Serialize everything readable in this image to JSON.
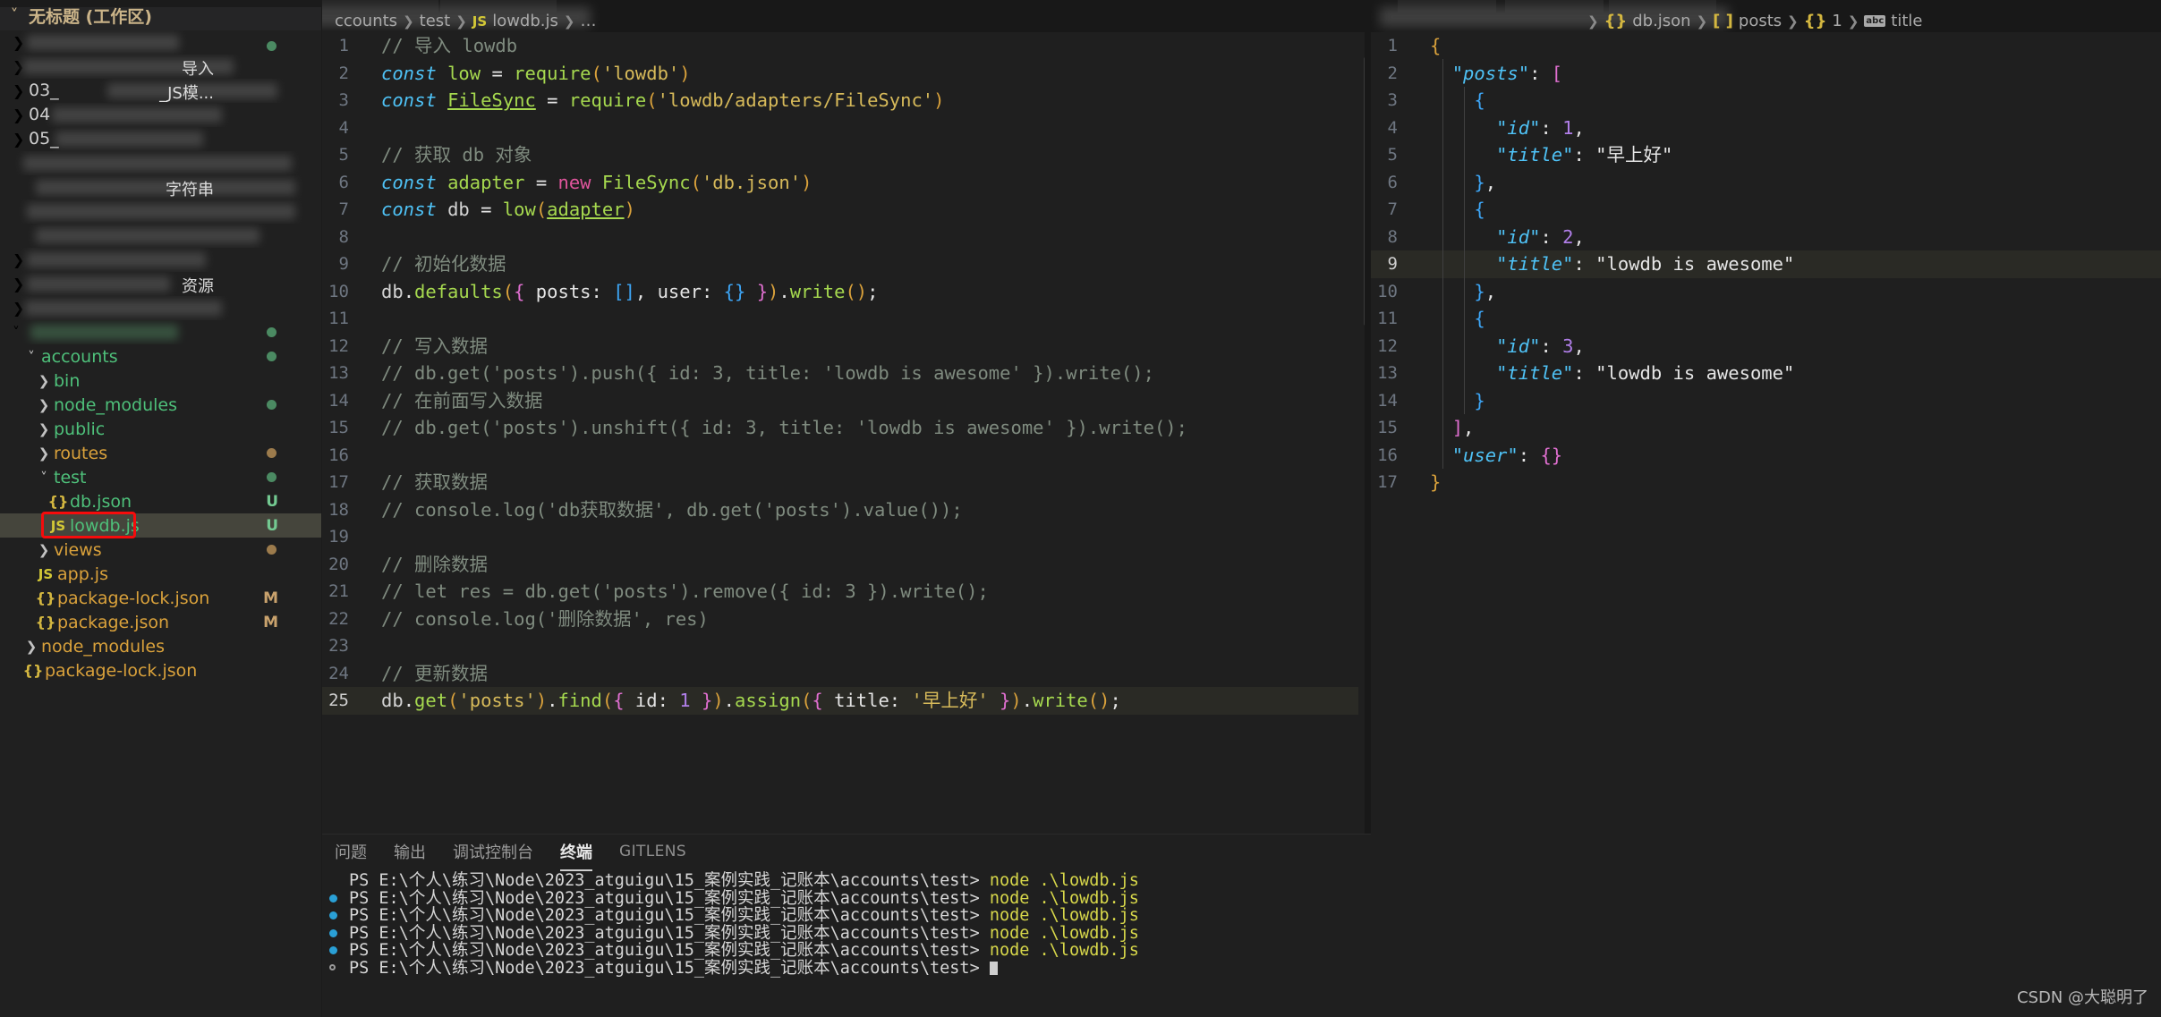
{
  "workspace": {
    "title": "无标题 (工作区)",
    "chevron": "chevron-down-icon"
  },
  "sidebar": {
    "blurred_items": [
      {
        "stub": "",
        "hint": ""
      },
      {
        "stub": "",
        "hint": "导入"
      },
      {
        "stub": "03_",
        "hint": "_JS模..."
      },
      {
        "stub": "04",
        "hint": ""
      },
      {
        "stub": "05_",
        "hint": ""
      },
      {
        "stub": "",
        "hint": ""
      },
      {
        "stub": "",
        "hint": "字符串"
      },
      {
        "stub": "",
        "hint": ""
      },
      {
        "stub": "",
        "hint": ""
      },
      {
        "stub": "",
        "hint": ""
      },
      {
        "stub": "",
        "hint": "资源"
      },
      {
        "stub": "",
        "hint": ""
      }
    ],
    "tree": [
      {
        "name": "accounts",
        "kind": "folder",
        "indent": 1,
        "expanded": true,
        "color": "green",
        "badge": "",
        "dot": "green"
      },
      {
        "name": "bin",
        "kind": "folder",
        "indent": 2,
        "expanded": false,
        "color": "green",
        "badge": "",
        "dot": ""
      },
      {
        "name": "node_modules",
        "kind": "folder",
        "indent": 2,
        "expanded": false,
        "color": "green",
        "badge": "",
        "dot": "green"
      },
      {
        "name": "public",
        "kind": "folder",
        "indent": 2,
        "expanded": false,
        "color": "green",
        "badge": "",
        "dot": ""
      },
      {
        "name": "routes",
        "kind": "folder",
        "indent": 2,
        "expanded": false,
        "color": "amber",
        "badge": "",
        "dot": "amber"
      },
      {
        "name": "test",
        "kind": "folder",
        "indent": 2,
        "expanded": true,
        "color": "green",
        "badge": "",
        "dot": "green"
      },
      {
        "name": "db.json",
        "kind": "json",
        "indent": 3,
        "expanded": null,
        "color": "green",
        "badge": "U",
        "dot": ""
      },
      {
        "name": "lowdb.js",
        "kind": "js",
        "indent": 3,
        "expanded": null,
        "color": "green",
        "badge": "U",
        "dot": "",
        "selected": true
      },
      {
        "name": "views",
        "kind": "folder",
        "indent": 2,
        "expanded": false,
        "color": "amber",
        "badge": "",
        "dot": "amber"
      },
      {
        "name": "app.js",
        "kind": "js",
        "indent": 2,
        "expanded": null,
        "color": "amber",
        "badge": "",
        "dot": ""
      },
      {
        "name": "package-lock.json",
        "kind": "json",
        "indent": 2,
        "expanded": null,
        "color": "amber",
        "badge": "M",
        "dot": ""
      },
      {
        "name": "package.json",
        "kind": "json",
        "indent": 2,
        "expanded": null,
        "color": "amber",
        "badge": "M",
        "dot": ""
      },
      {
        "name": "node_modules",
        "kind": "folder",
        "indent": 1,
        "expanded": false,
        "color": "amber",
        "badge": "",
        "dot": ""
      },
      {
        "name": "package-lock.json",
        "kind": "json",
        "indent": 1,
        "expanded": null,
        "color": "amber",
        "badge": "",
        "dot": ""
      }
    ]
  },
  "left_editor": {
    "breadcrumb": {
      "path_tail": "ccounts",
      "sep": "❯",
      "folder": "test",
      "file": "lowdb.js",
      "js_icon": "js-file-icon",
      "ellipsis": "…"
    },
    "active_line": 25,
    "lines": [
      {
        "n": 1,
        "tokens": [
          [
            "t-cmt",
            "// 导入 lowdb"
          ]
        ]
      },
      {
        "n": 2,
        "tokens": [
          [
            "t-kw",
            "const"
          ],
          [
            "t-plain",
            " "
          ],
          [
            "t-fn",
            "low"
          ],
          [
            "t-plain",
            " "
          ],
          [
            "t-op",
            "="
          ],
          [
            "t-plain",
            " "
          ],
          [
            "t-fn",
            "require"
          ],
          [
            "t-brk1",
            "("
          ],
          [
            "t-str",
            "'lowdb'"
          ],
          [
            "t-brk1",
            ")"
          ]
        ]
      },
      {
        "n": 3,
        "tokens": [
          [
            "t-kw",
            "const"
          ],
          [
            "t-plain",
            " "
          ],
          [
            "t-cls",
            "FileSync"
          ],
          [
            "t-plain",
            " "
          ],
          [
            "t-op",
            "="
          ],
          [
            "t-plain",
            " "
          ],
          [
            "t-fn",
            "require"
          ],
          [
            "t-brk1",
            "("
          ],
          [
            "t-str",
            "'lowdb/adapters/FileSync'"
          ],
          [
            "t-brk1",
            ")"
          ]
        ]
      },
      {
        "n": 4,
        "tokens": []
      },
      {
        "n": 5,
        "tokens": [
          [
            "t-cmt",
            "// 获取 db 对象"
          ]
        ]
      },
      {
        "n": 6,
        "tokens": [
          [
            "t-kw",
            "const"
          ],
          [
            "t-plain",
            " "
          ],
          [
            "t-fn",
            "adapter"
          ],
          [
            "t-plain",
            " "
          ],
          [
            "t-op",
            "="
          ],
          [
            "t-plain",
            " "
          ],
          [
            "t-new",
            "new"
          ],
          [
            "t-plain",
            " "
          ],
          [
            "t-fn",
            "FileSync"
          ],
          [
            "t-brk1",
            "("
          ],
          [
            "t-str",
            "'db.json'"
          ],
          [
            "t-brk1",
            ")"
          ]
        ]
      },
      {
        "n": 7,
        "tokens": [
          [
            "t-kw",
            "const"
          ],
          [
            "t-plain",
            " "
          ],
          [
            "t-id",
            "db"
          ],
          [
            "t-plain",
            " "
          ],
          [
            "t-op",
            "="
          ],
          [
            "t-plain",
            " "
          ],
          [
            "t-fn",
            "low"
          ],
          [
            "t-brk1",
            "("
          ],
          [
            "t-cls",
            "adapter"
          ],
          [
            "t-brk1",
            ")"
          ]
        ]
      },
      {
        "n": 8,
        "tokens": []
      },
      {
        "n": 9,
        "tokens": [
          [
            "t-cmt",
            "// 初始化数据"
          ]
        ]
      },
      {
        "n": 10,
        "tokens": [
          [
            "t-id",
            "db"
          ],
          [
            "t-plain",
            "."
          ],
          [
            "t-prop",
            "defaults"
          ],
          [
            "t-brk1",
            "("
          ],
          [
            "t-brk2",
            "{"
          ],
          [
            "t-plain",
            " posts: "
          ],
          [
            "t-brk3",
            "[]"
          ],
          [
            "t-plain",
            ", user: "
          ],
          [
            "t-brk3",
            "{}"
          ],
          [
            "t-plain",
            " "
          ],
          [
            "t-brk2",
            "}"
          ],
          [
            "t-brk1",
            ")"
          ],
          [
            "t-plain",
            "."
          ],
          [
            "t-prop",
            "write"
          ],
          [
            "t-brk1",
            "()"
          ],
          [
            "t-plain",
            ";"
          ]
        ]
      },
      {
        "n": 11,
        "tokens": []
      },
      {
        "n": 12,
        "tokens": [
          [
            "t-cmt",
            "// 写入数据"
          ]
        ]
      },
      {
        "n": 13,
        "tokens": [
          [
            "t-cmt",
            "// db.get('posts').push({ id: 3, title: 'lowdb is awesome' }).write();"
          ]
        ]
      },
      {
        "n": 14,
        "tokens": [
          [
            "t-cmt",
            "// 在前面写入数据"
          ]
        ]
      },
      {
        "n": 15,
        "tokens": [
          [
            "t-cmt",
            "// db.get('posts').unshift({ id: 3, title: 'lowdb is awesome' }).write();"
          ]
        ]
      },
      {
        "n": 16,
        "tokens": []
      },
      {
        "n": 17,
        "tokens": [
          [
            "t-cmt",
            "// 获取数据"
          ]
        ]
      },
      {
        "n": 18,
        "tokens": [
          [
            "t-cmt",
            "// console.log('db获取数据', db.get('posts').value());"
          ]
        ]
      },
      {
        "n": 19,
        "tokens": []
      },
      {
        "n": 20,
        "tokens": [
          [
            "t-cmt",
            "// 删除数据"
          ]
        ]
      },
      {
        "n": 21,
        "tokens": [
          [
            "t-cmt",
            "// let res = db.get('posts').remove({ id: 3 }).write();"
          ]
        ]
      },
      {
        "n": 22,
        "tokens": [
          [
            "t-cmt",
            "// console.log('删除数据', res)"
          ]
        ]
      },
      {
        "n": 23,
        "tokens": []
      },
      {
        "n": 24,
        "tokens": [
          [
            "t-cmt",
            "// 更新数据"
          ]
        ]
      },
      {
        "n": 25,
        "tokens": [
          [
            "t-id",
            "db"
          ],
          [
            "t-plain",
            "."
          ],
          [
            "t-prop",
            "get"
          ],
          [
            "t-brk1",
            "("
          ],
          [
            "t-str",
            "'posts'"
          ],
          [
            "t-brk1",
            ")"
          ],
          [
            "t-plain",
            "."
          ],
          [
            "t-prop",
            "find"
          ],
          [
            "t-brk1",
            "("
          ],
          [
            "t-brk2",
            "{"
          ],
          [
            "t-plain",
            " id: "
          ],
          [
            "t-num",
            "1"
          ],
          [
            "t-plain",
            " "
          ],
          [
            "t-brk2",
            "}"
          ],
          [
            "t-brk1",
            ")"
          ],
          [
            "t-plain",
            "."
          ],
          [
            "t-prop",
            "assign"
          ],
          [
            "t-brk1",
            "("
          ],
          [
            "t-brk2",
            "{"
          ],
          [
            "t-plain",
            " title: "
          ],
          [
            "t-str",
            "'早上好'"
          ],
          [
            "t-plain",
            " "
          ],
          [
            "t-brk2",
            "}"
          ],
          [
            "t-brk1",
            ")"
          ],
          [
            "t-plain",
            "."
          ],
          [
            "t-prop",
            "write"
          ],
          [
            "t-brk1",
            "()"
          ],
          [
            "t-plain",
            ";"
          ]
        ]
      }
    ]
  },
  "right_editor": {
    "breadcrumb": {
      "sep": "❯",
      "file": "db.json",
      "array": "posts",
      "object": "1",
      "field": "title",
      "json_icon": "json-file-icon",
      "array_icon": "array-icon",
      "object_icon": "object-icon",
      "string_icon": "string-field-icon"
    },
    "active_line": 9,
    "lines": [
      {
        "n": 1,
        "tokens": [
          [
            "j-b1",
            "{"
          ]
        ]
      },
      {
        "n": 2,
        "tokens": [
          [
            "j-p",
            "  "
          ],
          [
            "j-key",
            "\"posts\""
          ],
          [
            "j-p",
            ": "
          ],
          [
            "j-b2",
            "["
          ]
        ]
      },
      {
        "n": 3,
        "tokens": [
          [
            "j-p",
            "    "
          ],
          [
            "j-b3",
            "{"
          ]
        ]
      },
      {
        "n": 4,
        "tokens": [
          [
            "j-p",
            "      "
          ],
          [
            "j-key",
            "\"id\""
          ],
          [
            "j-p",
            ": "
          ],
          [
            "j-num",
            "1"
          ],
          [
            "j-p",
            ","
          ]
        ]
      },
      {
        "n": 5,
        "tokens": [
          [
            "j-p",
            "      "
          ],
          [
            "j-key",
            "\"title\""
          ],
          [
            "j-p",
            ": "
          ],
          [
            "j-str",
            "\"早上好\""
          ]
        ]
      },
      {
        "n": 6,
        "tokens": [
          [
            "j-p",
            "    "
          ],
          [
            "j-b3",
            "}"
          ],
          [
            "j-p",
            ","
          ]
        ]
      },
      {
        "n": 7,
        "tokens": [
          [
            "j-p",
            "    "
          ],
          [
            "j-b3",
            "{"
          ]
        ]
      },
      {
        "n": 8,
        "tokens": [
          [
            "j-p",
            "      "
          ],
          [
            "j-key",
            "\"id\""
          ],
          [
            "j-p",
            ": "
          ],
          [
            "j-num",
            "2"
          ],
          [
            "j-p",
            ","
          ]
        ]
      },
      {
        "n": 9,
        "tokens": [
          [
            "j-p",
            "      "
          ],
          [
            "j-key",
            "\"title\""
          ],
          [
            "j-p",
            ": "
          ],
          [
            "j-str",
            "\"lowdb is awesome\""
          ]
        ]
      },
      {
        "n": 10,
        "tokens": [
          [
            "j-p",
            "    "
          ],
          [
            "j-b3",
            "}"
          ],
          [
            "j-p",
            ","
          ]
        ]
      },
      {
        "n": 11,
        "tokens": [
          [
            "j-p",
            "    "
          ],
          [
            "j-b3",
            "{"
          ]
        ]
      },
      {
        "n": 12,
        "tokens": [
          [
            "j-p",
            "      "
          ],
          [
            "j-key",
            "\"id\""
          ],
          [
            "j-p",
            ": "
          ],
          [
            "j-num",
            "3"
          ],
          [
            "j-p",
            ","
          ]
        ]
      },
      {
        "n": 13,
        "tokens": [
          [
            "j-p",
            "      "
          ],
          [
            "j-key",
            "\"title\""
          ],
          [
            "j-p",
            ": "
          ],
          [
            "j-str",
            "\"lowdb is awesome\""
          ]
        ]
      },
      {
        "n": 14,
        "tokens": [
          [
            "j-p",
            "    "
          ],
          [
            "j-b3",
            "}"
          ]
        ]
      },
      {
        "n": 15,
        "tokens": [
          [
            "j-p",
            "  "
          ],
          [
            "j-b2",
            "]"
          ],
          [
            "j-p",
            ","
          ]
        ]
      },
      {
        "n": 16,
        "tokens": [
          [
            "j-p",
            "  "
          ],
          [
            "j-key",
            "\"user\""
          ],
          [
            "j-p",
            ": "
          ],
          [
            "j-b2",
            "{}"
          ]
        ]
      },
      {
        "n": 17,
        "tokens": [
          [
            "j-b1",
            "}"
          ]
        ]
      }
    ]
  },
  "panel": {
    "tabs": [
      {
        "label": "问题",
        "active": false
      },
      {
        "label": "输出",
        "active": false
      },
      {
        "label": "调试控制台",
        "active": false
      },
      {
        "label": "终端",
        "active": true
      },
      {
        "label": "GITLENS",
        "active": false
      }
    ],
    "prompt": "PS E:\\个人\\练习\\Node\\2023_atguigu\\15_案例实践_记账本\\accounts\\test>",
    "command": "node .\\lowdb.js",
    "lines": [
      {
        "bullet": "",
        "command": "node .\\lowdb.js"
      },
      {
        "bullet": "blue",
        "command": "node .\\lowdb.js"
      },
      {
        "bullet": "blue",
        "command": "node .\\lowdb.js"
      },
      {
        "bullet": "blue",
        "command": "node .\\lowdb.js"
      },
      {
        "bullet": "blue",
        "command": "node .\\lowdb.js"
      },
      {
        "bullet": "ring",
        "command": ""
      }
    ]
  },
  "watermark": "CSDN @大聪明了",
  "colors": {
    "accent_red": "#f50c0c",
    "selection": "#45453c",
    "folder_green": "#4ec07a",
    "folder_amber": "#d9a13b",
    "badge_untracked": "#73c991",
    "badge_modified": "#c9a26d"
  }
}
